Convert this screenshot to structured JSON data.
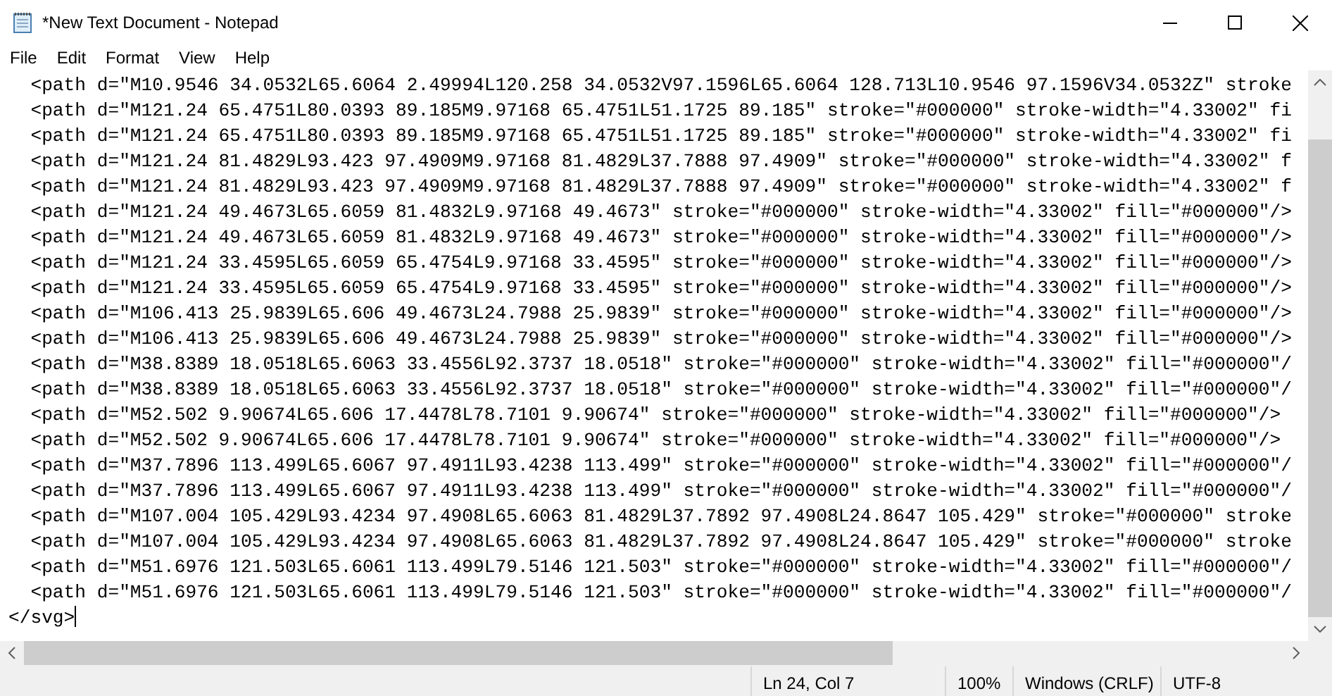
{
  "window": {
    "title": "*New Text Document - Notepad"
  },
  "menu": [
    "File",
    "Edit",
    "Format",
    "View",
    "Help"
  ],
  "lines": [
    "  <path d=\"M10.9546 34.0532L65.6064 2.49994L120.258 34.0532V97.1596L65.6064 128.713L10.9546 97.1596V34.0532Z\" stroke",
    "  <path d=\"M121.24 65.4751L80.0393 89.185M9.97168 65.4751L51.1725 89.185\" stroke=\"#000000\" stroke-width=\"4.33002\" fi",
    "  <path d=\"M121.24 65.4751L80.0393 89.185M9.97168 65.4751L51.1725 89.185\" stroke=\"#000000\" stroke-width=\"4.33002\" fi",
    "  <path d=\"M121.24 81.4829L93.423 97.4909M9.97168 81.4829L37.7888 97.4909\" stroke=\"#000000\" stroke-width=\"4.33002\" f",
    "  <path d=\"M121.24 81.4829L93.423 97.4909M9.97168 81.4829L37.7888 97.4909\" stroke=\"#000000\" stroke-width=\"4.33002\" f",
    "  <path d=\"M121.24 49.4673L65.6059 81.4832L9.97168 49.4673\" stroke=\"#000000\" stroke-width=\"4.33002\" fill=\"#000000\"/>",
    "  <path d=\"M121.24 49.4673L65.6059 81.4832L9.97168 49.4673\" stroke=\"#000000\" stroke-width=\"4.33002\" fill=\"#000000\"/>",
    "  <path d=\"M121.24 33.4595L65.6059 65.4754L9.97168 33.4595\" stroke=\"#000000\" stroke-width=\"4.33002\" fill=\"#000000\"/>",
    "  <path d=\"M121.24 33.4595L65.6059 65.4754L9.97168 33.4595\" stroke=\"#000000\" stroke-width=\"4.33002\" fill=\"#000000\"/>",
    "  <path d=\"M106.413 25.9839L65.606 49.4673L24.7988 25.9839\" stroke=\"#000000\" stroke-width=\"4.33002\" fill=\"#000000\"/>",
    "  <path d=\"M106.413 25.9839L65.606 49.4673L24.7988 25.9839\" stroke=\"#000000\" stroke-width=\"4.33002\" fill=\"#000000\"/>",
    "  <path d=\"M38.8389 18.0518L65.6063 33.4556L92.3737 18.0518\" stroke=\"#000000\" stroke-width=\"4.33002\" fill=\"#000000\"/",
    "  <path d=\"M38.8389 18.0518L65.6063 33.4556L92.3737 18.0518\" stroke=\"#000000\" stroke-width=\"4.33002\" fill=\"#000000\"/",
    "  <path d=\"M52.502 9.90674L65.606 17.4478L78.7101 9.90674\" stroke=\"#000000\" stroke-width=\"4.33002\" fill=\"#000000\"/>",
    "  <path d=\"M52.502 9.90674L65.606 17.4478L78.7101 9.90674\" stroke=\"#000000\" stroke-width=\"4.33002\" fill=\"#000000\"/>",
    "  <path d=\"M37.7896 113.499L65.6067 97.4911L93.4238 113.499\" stroke=\"#000000\" stroke-width=\"4.33002\" fill=\"#000000\"/",
    "  <path d=\"M37.7896 113.499L65.6067 97.4911L93.4238 113.499\" stroke=\"#000000\" stroke-width=\"4.33002\" fill=\"#000000\"/",
    "  <path d=\"M107.004 105.429L93.4234 97.4908L65.6063 81.4829L37.7892 97.4908L24.8647 105.429\" stroke=\"#000000\" stroke",
    "  <path d=\"M107.004 105.429L93.4234 97.4908L65.6063 81.4829L37.7892 97.4908L24.8647 105.429\" stroke=\"#000000\" stroke",
    "  <path d=\"M51.6976 121.503L65.6061 113.499L79.5146 121.503\" stroke=\"#000000\" stroke-width=\"4.33002\" fill=\"#000000\"/",
    "  <path d=\"M51.6976 121.503L65.6061 113.499L79.5146 121.503\" stroke=\"#000000\" stroke-width=\"4.33002\" fill=\"#000000\"/",
    "</svg>"
  ],
  "status_bar": {
    "position": "Ln 24, Col 7",
    "zoom": "100%",
    "line_endings": "Windows (CRLF)",
    "encoding": "UTF-8"
  }
}
